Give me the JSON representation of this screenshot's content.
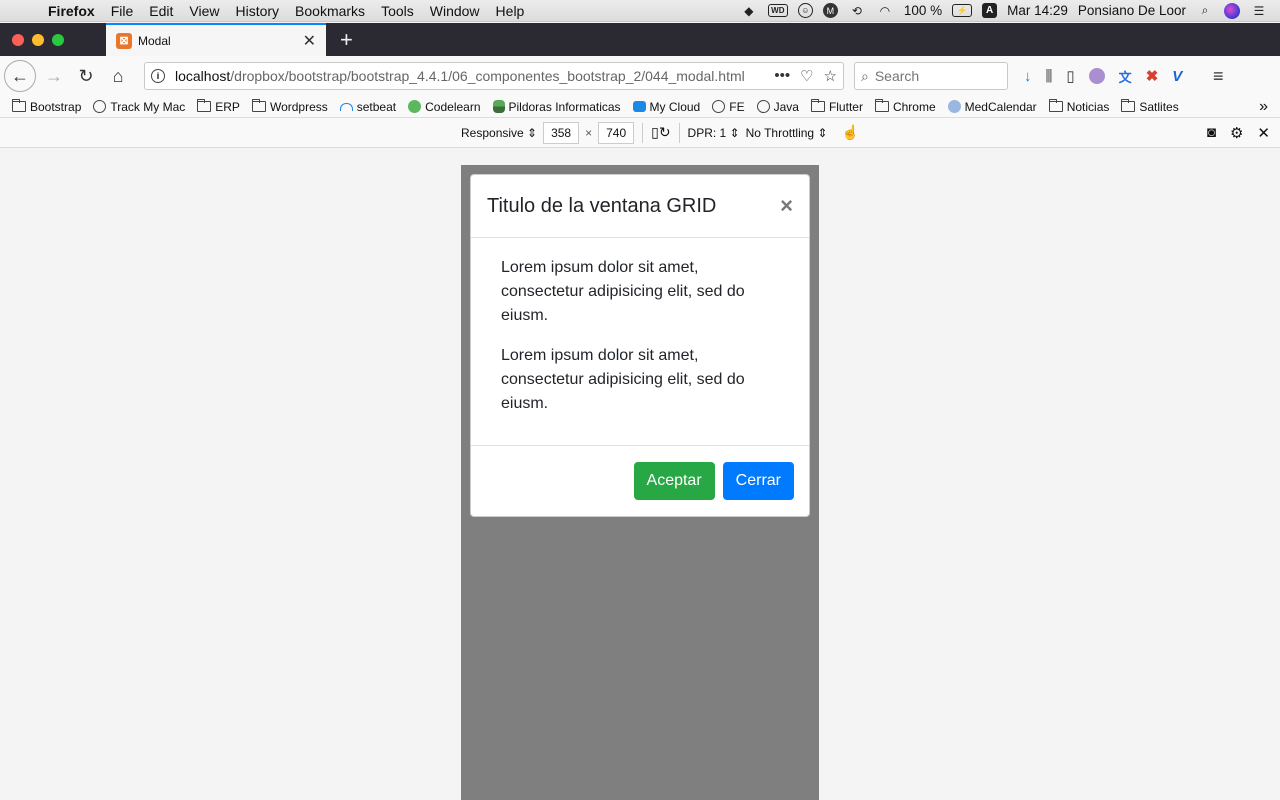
{
  "menubar": {
    "app_name": "Firefox",
    "items": [
      "File",
      "Edit",
      "View",
      "History",
      "Bookmarks",
      "Tools",
      "Window",
      "Help"
    ],
    "battery": "100 %",
    "input_source": "A",
    "clock": "Mar 14:29",
    "user": "Ponsiano De Loor"
  },
  "tab": {
    "title": "Modal"
  },
  "urlbar": {
    "host": "localhost",
    "path": "/dropbox/bootstrap/bootstrap_4.4.1/06_componentes_bootstrap_2/044_modal.html"
  },
  "search": {
    "placeholder": "Search"
  },
  "bookmarks": [
    {
      "label": "Bootstrap",
      "icon": "folder"
    },
    {
      "label": "Track My Mac",
      "icon": "globe"
    },
    {
      "label": "ERP",
      "icon": "folder"
    },
    {
      "label": "Wordpress",
      "icon": "folder"
    },
    {
      "label": "setbeat",
      "icon": "cloud"
    },
    {
      "label": "Codelearn",
      "icon": "green"
    },
    {
      "label": "Pildoras Informaticas",
      "icon": "pill"
    },
    {
      "label": "My Cloud",
      "icon": "blue"
    },
    {
      "label": "FE",
      "icon": "globe"
    },
    {
      "label": "Java",
      "icon": "globe"
    },
    {
      "label": "Flutter",
      "icon": "folder"
    },
    {
      "label": "Chrome",
      "icon": "folder"
    },
    {
      "label": "MedCalendar",
      "icon": "med"
    },
    {
      "label": "Noticias",
      "icon": "folder"
    },
    {
      "label": "Satlites",
      "icon": "folder"
    }
  ],
  "responsive": {
    "device": "Responsive",
    "width": "358",
    "height": "740",
    "times": "×",
    "dpr": "DPR: 1",
    "throttling": "No Throttling"
  },
  "modal": {
    "title": "Titulo de la ventana GRID",
    "close": "×",
    "paragraphs": [
      "Lorem ipsum dolor sit amet, consectetur adipisicing elit, sed do eiusm.",
      "Lorem ipsum dolor sit amet, consectetur adipisicing elit, sed do eiusm."
    ],
    "accept_label": "Aceptar",
    "close_label": "Cerrar"
  },
  "colors": {
    "success": "#28a745",
    "primary": "#007bff",
    "backdrop": "#7f7f7f"
  }
}
